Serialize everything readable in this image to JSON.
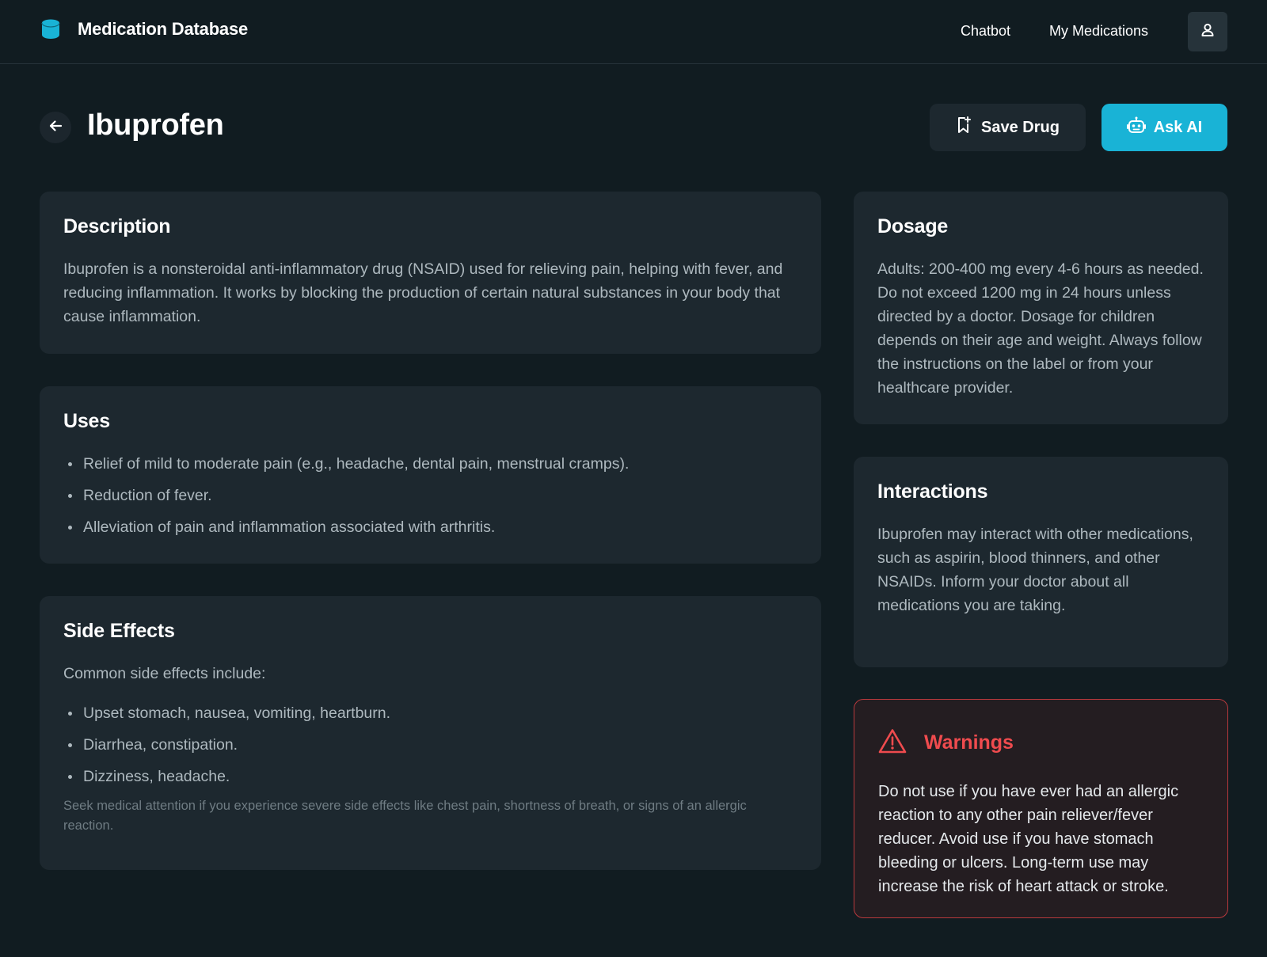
{
  "header": {
    "app_title": "Medication Database",
    "nav": [
      {
        "label": "Chatbot"
      },
      {
        "label": "My Medications"
      }
    ],
    "logo_icon": "database-icon",
    "user_icon": "user-icon"
  },
  "drug": {
    "name": "Ibuprofen",
    "back_icon": "arrow-left-icon"
  },
  "actions": {
    "save_label": "Save Drug",
    "save_icon": "bookmark-plus-icon",
    "ask_label": "Ask AI",
    "ask_icon": "robot-icon"
  },
  "description": {
    "title": "Description",
    "text": "Ibuprofen is a nonsteroidal anti-inflammatory drug (NSAID) used for relieving pain, helping with fever, and reducing inflammation. It works by blocking the production of certain natural substances in your body that cause inflammation."
  },
  "uses": {
    "title": "Uses",
    "items": [
      "Relief of mild to moderate pain (e.g., headache, dental pain, menstrual cramps).",
      "Reduction of fever.",
      "Alleviation of pain and inflammation associated with arthritis."
    ]
  },
  "side_effects": {
    "title": "Side Effects",
    "intro": "Common side effects include:",
    "items": [
      "Upset stomach, nausea, vomiting, heartburn.",
      "Diarrhea, constipation.",
      "Dizziness, headache."
    ],
    "note": "Seek medical attention if you experience severe side effects like chest pain, shortness of breath, or signs of an allergic reaction."
  },
  "dosage": {
    "title": "Dosage",
    "text": "Adults: 200-400 mg every 4-6 hours as needed. Do not exceed 1200 mg in 24 hours unless directed by a doctor. Dosage for children depends on their age and weight. Always follow the instructions on the label or from your healthcare provider."
  },
  "interactions": {
    "title": "Interactions",
    "text": "Ibuprofen may interact with other medications, such as aspirin, blood thinners, and other NSAIDs. Inform your doctor about all medications you are taking."
  },
  "warnings": {
    "title": "Warnings",
    "icon": "warning-triangle-icon",
    "text": "Do not use if you have ever had an allergic reaction to any other pain reliever/fever reducer. Avoid use if you have stomach bleeding or ulcers. Long-term use may increase the risk of heart attack or stroke."
  },
  "colors": {
    "background": "#111c21",
    "card": "#1d282f",
    "accent": "#19b3d6",
    "warning": "#ef4b4e"
  }
}
